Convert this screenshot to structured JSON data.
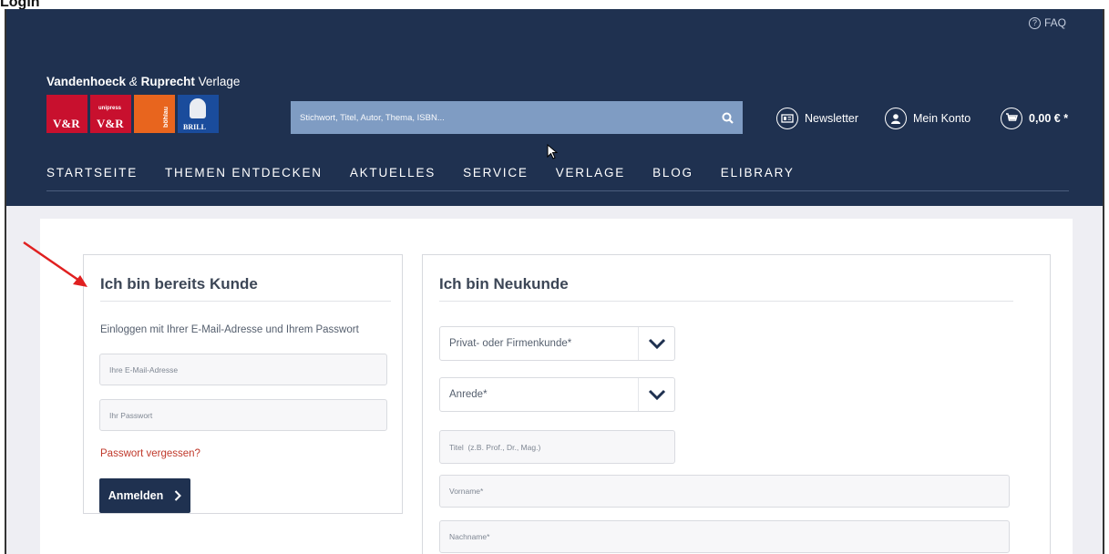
{
  "caption": "Login",
  "header": {
    "faq_label": "FAQ",
    "brand_bold": "Vandenhoeck",
    "brand_amp": "&",
    "brand_bold2": "Ruprecht",
    "brand_rest": "Verlage",
    "logos": [
      {
        "name": "vr-logo",
        "text": "V&R"
      },
      {
        "name": "vr-unipress-logo",
        "small": "unipress",
        "text": "V&R"
      },
      {
        "name": "boehlau-logo",
        "text": "böhlau"
      },
      {
        "name": "brill-logo",
        "text": "BRILL"
      }
    ],
    "search": {
      "placeholder": "Stichwort, Titel, Autor, Thema, ISBN..."
    },
    "newsletter_label": "Newsletter",
    "account_label": "Mein Konto",
    "cart_label": "0,00 € *"
  },
  "nav": [
    "STARTSEITE",
    "THEMEN ENTDECKEN",
    "AKTUELLES",
    "SERVICE",
    "VERLAGE",
    "BLOG",
    "ELIBRARY"
  ],
  "login": {
    "title": "Ich bin bereits Kunde",
    "description": "Einloggen mit Ihrer E-Mail-Adresse und Ihrem Passwort",
    "email_placeholder": "Ihre E-Mail-Adresse",
    "password_placeholder": "Ihr Passwort",
    "forgot_label": "Passwort vergessen?",
    "submit_label": "Anmelden"
  },
  "register": {
    "title": "Ich bin Neukunde",
    "customer_type": "Privat- oder Firmenkunde*",
    "salutation": "Anrede*",
    "title_placeholder": "Titel  (z.B. Prof., Dr., Mag.)",
    "firstname_placeholder": "Vorname*",
    "lastname_placeholder": "Nachname*"
  },
  "colors": {
    "header": "#1f3150",
    "accent_red": "#c0392b",
    "search": "#7f9cc3"
  }
}
